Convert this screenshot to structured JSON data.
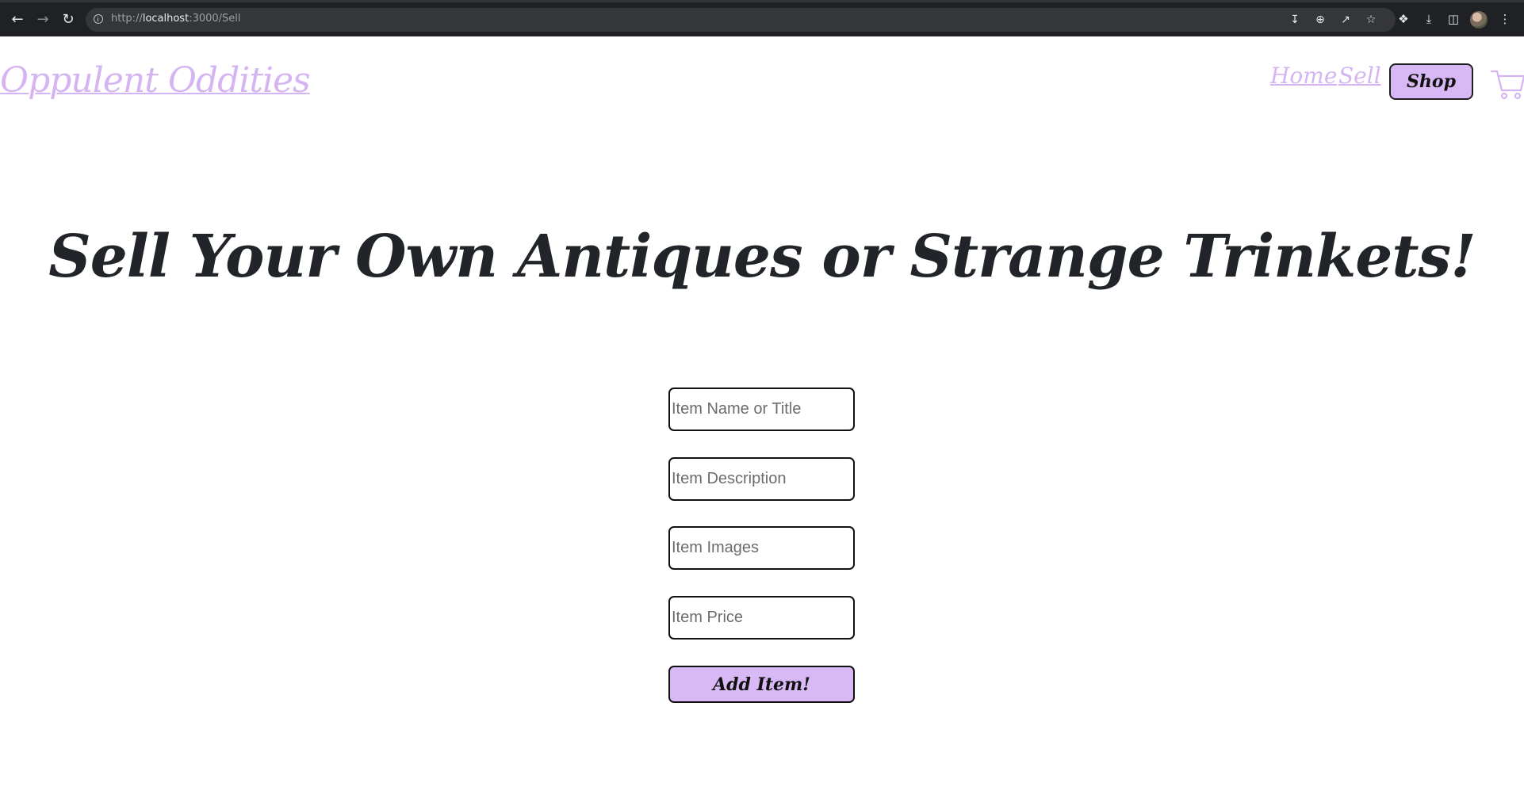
{
  "browser": {
    "url_scheme": "http://",
    "url_host": "localhost",
    "url_path": ":3000/Sell",
    "icons": {
      "back": "arrow-left-icon",
      "forward": "arrow-right-icon",
      "reload": "reload-icon",
      "site_info": "info-icon",
      "install": "install-app-icon",
      "zoom": "zoom-icon",
      "share": "share-icon",
      "bookmark": "star-icon",
      "extensions": "puzzle-icon",
      "downloads": "download-icon",
      "side_panel": "side-panel-icon",
      "menu": "kebab-menu-icon"
    }
  },
  "header": {
    "brand": "Oppulent Oddities",
    "nav": {
      "home": "Home",
      "sell": "Sell",
      "shop": "Shop"
    },
    "cart_icon": "cart-icon"
  },
  "main": {
    "headline": "Sell Your Own Antiques or Strange Trinkets!",
    "form": {
      "name_placeholder": "Item Name or Title",
      "description_placeholder": "Item Description",
      "images_placeholder": "Item Images",
      "price_placeholder": "Item Price",
      "submit_label": "Add Item!"
    }
  },
  "colors": {
    "accent": "#d8b9f6",
    "link": "#d4b5f2",
    "text": "#212529"
  }
}
